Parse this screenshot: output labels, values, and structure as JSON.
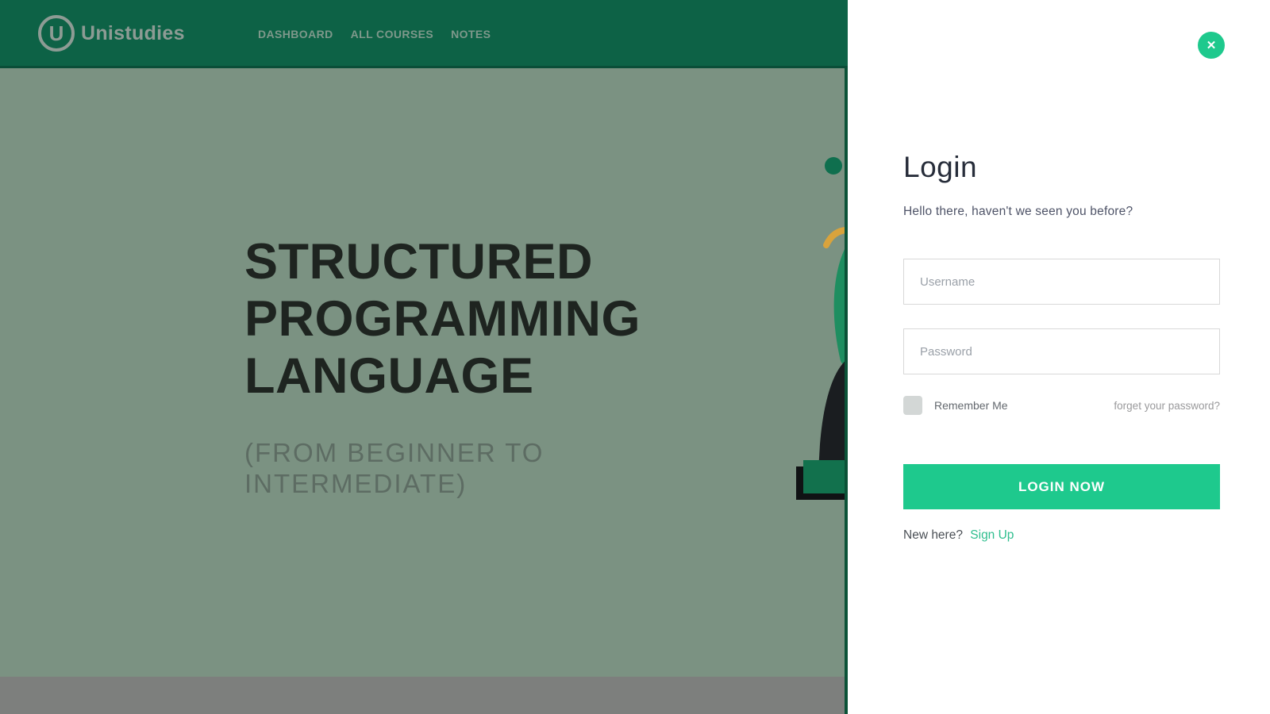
{
  "header": {
    "brand": "Unistudies",
    "logo_letter": "U",
    "nav": [
      {
        "label": "DASHBOARD"
      },
      {
        "label": "ALL COURSES"
      },
      {
        "label": "NOTES"
      }
    ]
  },
  "hero": {
    "title_lines": [
      "STRUCTURED",
      "PROGRAMMING",
      "LANGUAGE"
    ],
    "subtitle": "(FROM BEGINNER TO INTERMEDIATE)"
  },
  "login": {
    "title": "Login",
    "subtitle": "Hello there, haven't we seen you before?",
    "username_placeholder": "Username",
    "username_value": "",
    "password_placeholder": "Password",
    "password_value": "",
    "remember_label": "Remember Me",
    "remember_checked": false,
    "forgot_link": "forget your password?",
    "submit_label": "LOGIN NOW",
    "signup_prompt": "New here?",
    "signup_link": "Sign Up"
  },
  "icons": {
    "close": "✕"
  },
  "colors": {
    "header_green": "#0d6246",
    "hero_sage": "#7b9282",
    "accent_green": "#1ec98d",
    "signup_green": "#2fbe8e",
    "title_dark": "#1e2420",
    "bottom_bar_gray": "#7d7f7d"
  }
}
